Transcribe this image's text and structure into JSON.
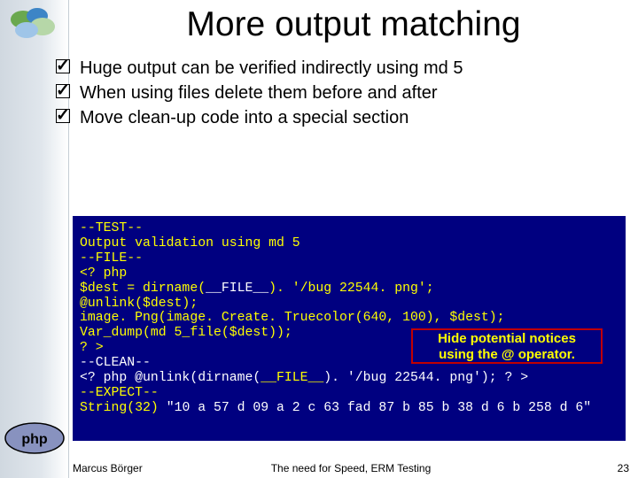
{
  "title": "More output matching",
  "bullets": [
    "Huge output can be verified indirectly using md 5",
    "When using files delete them before and after",
    "Move clean-up code into a special section"
  ],
  "code": {
    "l1": "--TEST--",
    "l2": "Output validation using md 5",
    "l3": "--FILE--",
    "l4": "<? php",
    "l5a": "$dest = dirname(",
    "l5b": "__FILE__",
    "l5c": "). '/bug 22544. png';",
    "l6": "@unlink($dest);",
    "l7": "image. Png(image. Create. Truecolor(640, 100), $dest);",
    "l8": "Var_dump(md 5_file($dest));",
    "l9": "? >",
    "l10": "--CLEAN--",
    "l11a": "<? php @unlink(dirname(",
    "l11b": "__FILE__",
    "l11c": "). '/bug 22544. png'); ? >",
    "l12": "--EXPECT--",
    "l13a": "String(32) ",
    "l13b": "\"10 a 57 d 09 a 2 c 63 fad 87 b 85 b 38 d 6 b 258 d 6\""
  },
  "callout": {
    "line1": "Hide potential notices",
    "line2": "using the @ operator."
  },
  "footer": {
    "left": "Marcus Börger",
    "center": "The need for Speed, ERM Testing",
    "right": "23"
  },
  "icons": {
    "cloud": "cloud-logo-icon",
    "php": "php-logo-icon"
  }
}
